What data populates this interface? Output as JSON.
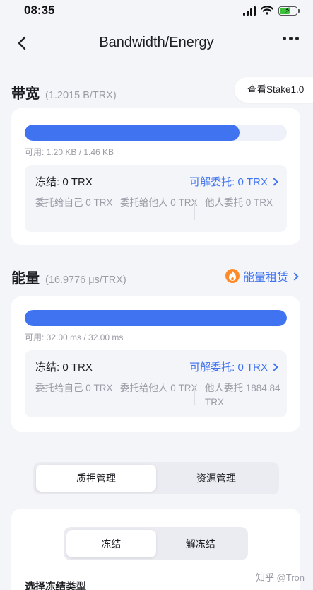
{
  "status_bar": {
    "time": "08:35",
    "icons": [
      "signal-icon",
      "wifi-icon",
      "battery-charging-icon"
    ]
  },
  "nav": {
    "title": "Bandwidth/Energy",
    "back_icon": "chevron-left-icon",
    "more_icon": "more-icon"
  },
  "bandwidth": {
    "title": "带宽",
    "rate": "(1.2015 B/TRX)",
    "stake_link": "查看Stake1.0",
    "progress": 0.82,
    "available": "可用: 1.20 KB / 1.46 KB",
    "frozen": "冻结: 0 TRX",
    "undelegate": "可解委托: 0 TRX",
    "stats": [
      "委托给自己 0 TRX",
      "委托给他人 0 TRX",
      "他人委托 0 TRX"
    ]
  },
  "energy": {
    "title": "能量",
    "rate": "(16.9776 μs/TRX)",
    "rental": "能量租赁",
    "progress": 1.0,
    "available": "可用: 32.00 ms / 32.00 ms",
    "frozen": "冻结: 0 TRX",
    "undelegate": "可解委托: 0 TRX",
    "stats": [
      "委托给自己 0 TRX",
      "委托给他人 0 TRX",
      "他人委托 1884.84 TRX"
    ]
  },
  "main_tabs": {
    "items": [
      "质押管理",
      "资源管理"
    ],
    "selected": "质押管理"
  },
  "freeze_tabs": {
    "items": [
      "冻结",
      "解冻结"
    ],
    "selected": "冻结"
  },
  "freeze_type_label": "选择冻结类型",
  "watermark": "知乎 @Tron",
  "colors": {
    "accent": "#3f73f0",
    "background": "#f4f5f9",
    "rental_icon": "#ff8a2a"
  }
}
